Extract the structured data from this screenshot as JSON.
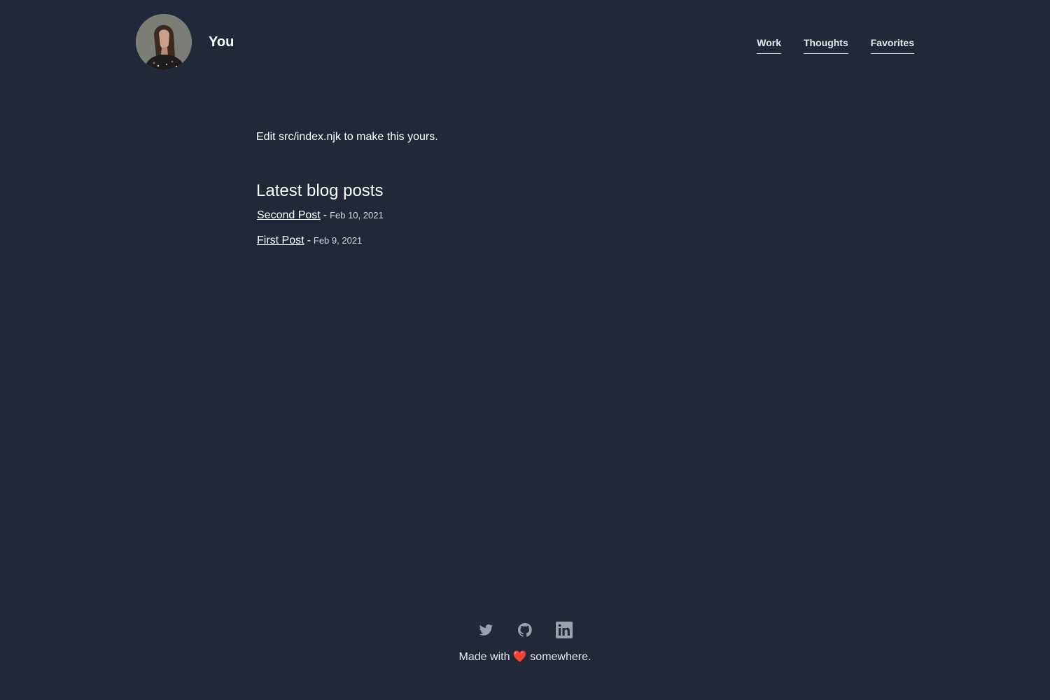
{
  "header": {
    "site_name": "You",
    "avatar_alt": "avatar",
    "nav": [
      {
        "label": "Work"
      },
      {
        "label": "Thoughts"
      },
      {
        "label": "Favorites"
      }
    ]
  },
  "main": {
    "intro": "Edit src/index.njk to make this yours.",
    "blog_heading": "Latest blog posts",
    "posts": [
      {
        "title": "Second Post",
        "separator": "-",
        "date": "Feb 10, 2021"
      },
      {
        "title": "First Post",
        "separator": "-",
        "date": "Feb 9, 2021"
      }
    ]
  },
  "footer": {
    "social": [
      {
        "icon": "twitter-icon"
      },
      {
        "icon": "github-icon"
      },
      {
        "icon": "linkedin-icon"
      }
    ],
    "made_with_prefix": "Made with",
    "heart": "❤️",
    "made_with_suffix": "somewhere."
  },
  "colors": {
    "background": "#212939",
    "text": "#ffffff",
    "icon": "#9aa1ad",
    "heart": "#e0242f"
  }
}
